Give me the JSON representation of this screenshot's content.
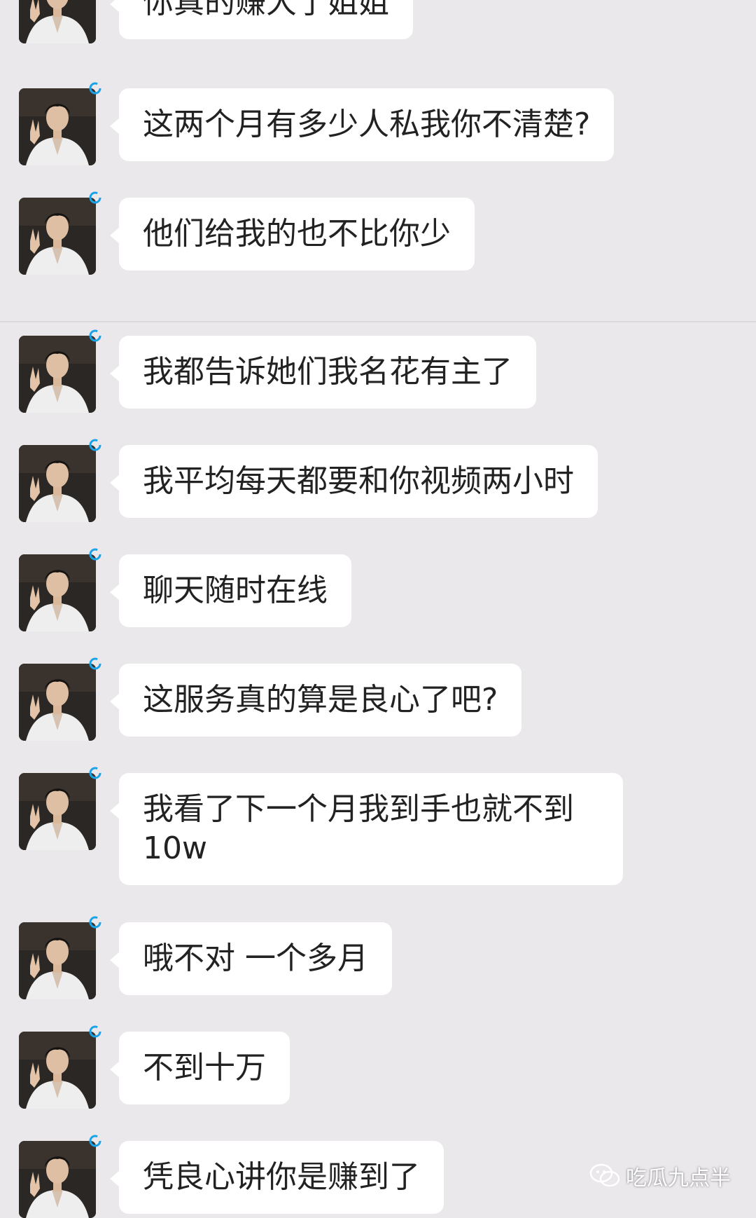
{
  "messages": [
    {
      "text": "你真的赚大了姐姐"
    },
    {
      "text": "这两个月有多少人私我你不清楚?"
    },
    {
      "text": "他们给我的也不比你少"
    },
    {
      "text": "我都告诉她们我名花有主了"
    },
    {
      "text": "我平均每天都要和你视频两小时"
    },
    {
      "text": "聊天随时在线"
    },
    {
      "text": "这服务真的算是良心了吧?"
    },
    {
      "text": "我看了下一个月我到手也就不到\n10w"
    },
    {
      "text": "哦不对 一个多月"
    },
    {
      "text": "不到十万"
    },
    {
      "text": "凭良心讲你是赚到了"
    }
  ],
  "watermark": {
    "label": "吃瓜九点半",
    "icon": "wechat-icon"
  },
  "colors": {
    "background": "#ebe8ec",
    "bubble": "#ffffff",
    "text": "#222222",
    "status_ring": "#1aa3e8"
  }
}
